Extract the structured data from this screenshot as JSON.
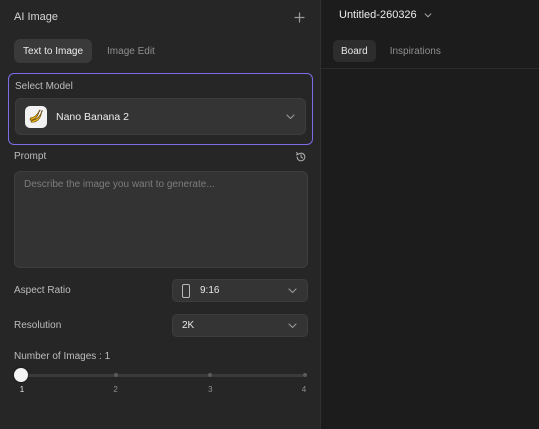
{
  "left_panel": {
    "title": "AI Image",
    "tabs": [
      {
        "label": "Text to Image",
        "active": true
      },
      {
        "label": "Image Edit",
        "active": false
      }
    ],
    "model": {
      "label": "Select Model",
      "selected": "Nano Banana 2",
      "icon": "banana-icon"
    },
    "prompt": {
      "label": "Prompt",
      "value": "",
      "placeholder": "Describe the image you want to generate..."
    },
    "aspect_ratio": {
      "label": "Aspect Ratio",
      "value": "9:16"
    },
    "resolution": {
      "label": "Resolution",
      "value": "2K"
    },
    "num_images": {
      "label": "Number of Images : 1",
      "value": 1,
      "options": [
        "1",
        "2",
        "3",
        "4"
      ]
    }
  },
  "right_panel": {
    "document_title": "Untitled-260326",
    "tabs": [
      {
        "label": "Board",
        "active": true
      },
      {
        "label": "Inspirations",
        "active": false
      }
    ]
  },
  "colors": {
    "accent_border": "#7b6ee6",
    "panel_bg": "#262626",
    "board_bg": "#1c1c1c"
  }
}
